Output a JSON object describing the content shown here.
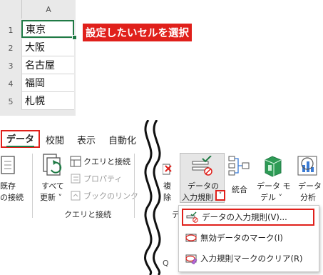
{
  "sheet": {
    "column_header": "A",
    "rows": [
      {
        "num": "1",
        "value": "東京"
      },
      {
        "num": "2",
        "value": "大阪"
      },
      {
        "num": "3",
        "value": "名古屋"
      },
      {
        "num": "4",
        "value": "福岡"
      },
      {
        "num": "5",
        "value": "札幌"
      }
    ],
    "callout": "設定したいセルを選択"
  },
  "ribbon_left": {
    "tabs": [
      "データ",
      "校閲",
      "表示",
      "自動化"
    ],
    "active_tab": "データ",
    "existing_conn_line1": "既存",
    "existing_conn_line2": "の接続",
    "refresh_line1": "すべて",
    "refresh_line2": "更新 ˅",
    "query_items": [
      "クエリと接続",
      "プロパティ",
      "ブックのリンク"
    ],
    "group_label": "クエリと接続"
  },
  "ribbon_right": {
    "dup_line1": "複",
    "dup_line2": "除",
    "validation_line1": "データの",
    "validation_line2": "入力規則",
    "dropdown_arrow": "˅",
    "consolidate": "統合",
    "data_model_line1": "データ モ",
    "data_model_line2": "デル ˅",
    "analysis_line1": "データ",
    "analysis_line2": "分析",
    "group_partial": "デ"
  },
  "menu": {
    "items": [
      {
        "label": "データの入力規則(V)...",
        "icon": "validation-icon"
      },
      {
        "label": "無効データのマーク(I)",
        "icon": "circle-invalid-icon"
      },
      {
        "label": "入力規則マークのクリア(R)",
        "icon": "clear-circles-icon"
      }
    ]
  },
  "sheet_bottom_partial": "Q",
  "colors": {
    "accent_red": "#e0201b",
    "excel_green": "#1f7a45"
  }
}
